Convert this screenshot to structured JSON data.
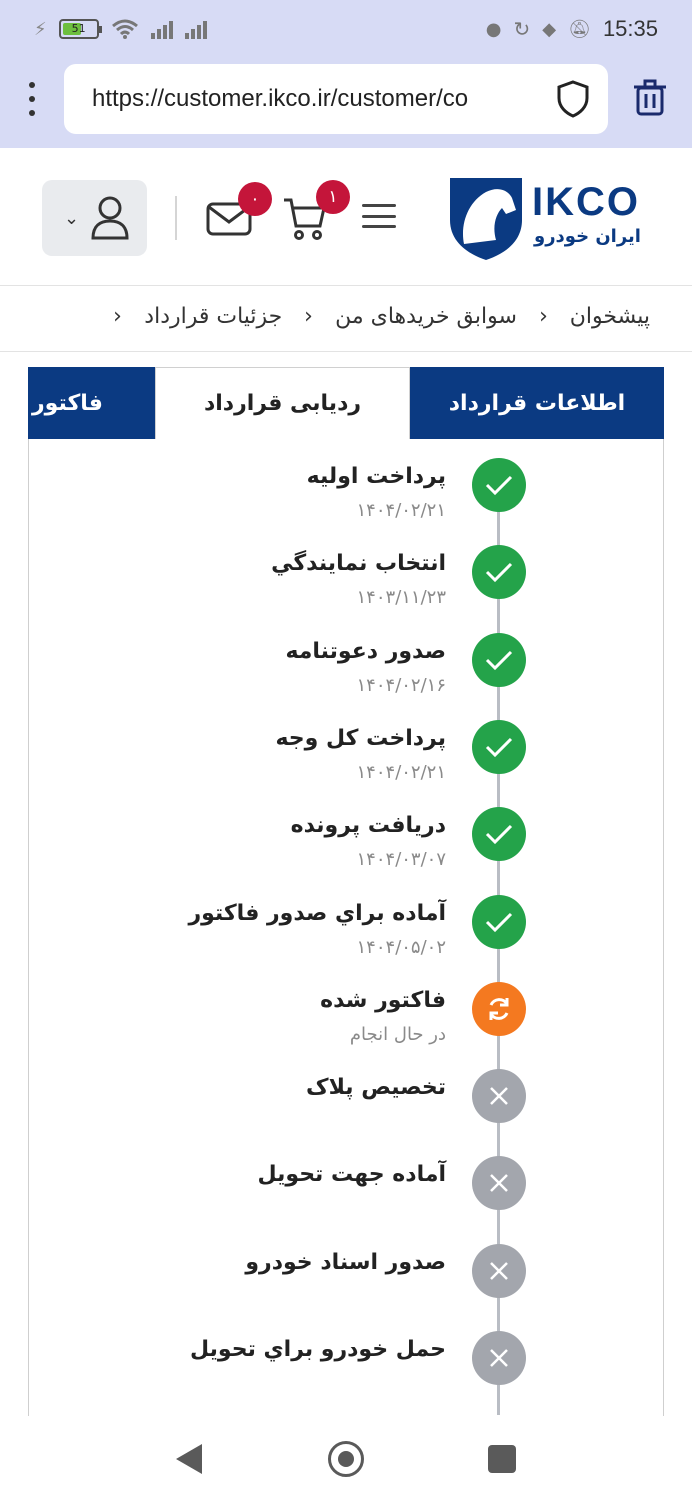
{
  "status_bar": {
    "battery": "51",
    "time": "15:35"
  },
  "browser": {
    "url": "https://customer.ikco.ir/customer/co",
    "icons": [
      "menu-dots-icon",
      "shield-icon",
      "trash-icon"
    ]
  },
  "header": {
    "logo_text": "IKCO",
    "logo_subtext": "ایران خودرو",
    "cart_badge": "۱",
    "messages_badge": "۰"
  },
  "breadcrumb": {
    "items": [
      "پیشخوان",
      "سوابق خریدهای من",
      "جزئیات قرارداد"
    ]
  },
  "tabs": {
    "info": "اطلاعات قرارداد",
    "tracking": "ردیابی قرارداد",
    "invoice": "فاکتور"
  },
  "timeline": {
    "steps": [
      {
        "title": "پرداخت اوليه",
        "date": "۱۴۰۴/۰۲/۲۱",
        "status": "done"
      },
      {
        "title": "انتخاب نمايندگي",
        "date": "۱۴۰۳/۱۱/۲۳",
        "status": "done"
      },
      {
        "title": "صدور دعوتنامه",
        "date": "۱۴۰۴/۰۲/۱۶",
        "status": "done"
      },
      {
        "title": "پرداخت کل وجه",
        "date": "۱۴۰۴/۰۲/۲۱",
        "status": "done"
      },
      {
        "title": "دريافت پرونده",
        "date": "۱۴۰۴/۰۳/۰۷",
        "status": "done"
      },
      {
        "title": "آماده براي صدور فاکتور",
        "date": "۱۴۰۴/۰۵/۰۲",
        "status": "done"
      },
      {
        "title": "فاکتور شده",
        "date": "در حال انجام",
        "status": "in-progress"
      },
      {
        "title": "تخصيص پلاک",
        "date": "",
        "status": "pending"
      },
      {
        "title": "آماده جهت تحويل",
        "date": "",
        "status": "pending"
      },
      {
        "title": "صدور اسناد خودرو",
        "date": "",
        "status": "pending"
      },
      {
        "title": "حمل خودرو براي تحويل",
        "date": "",
        "status": "pending"
      }
    ]
  },
  "colors": {
    "primary": "#0b3a82",
    "done": "#24a34a",
    "in_progress": "#f47920",
    "pending": "#a3a6ad",
    "badge": "#c4153a"
  }
}
